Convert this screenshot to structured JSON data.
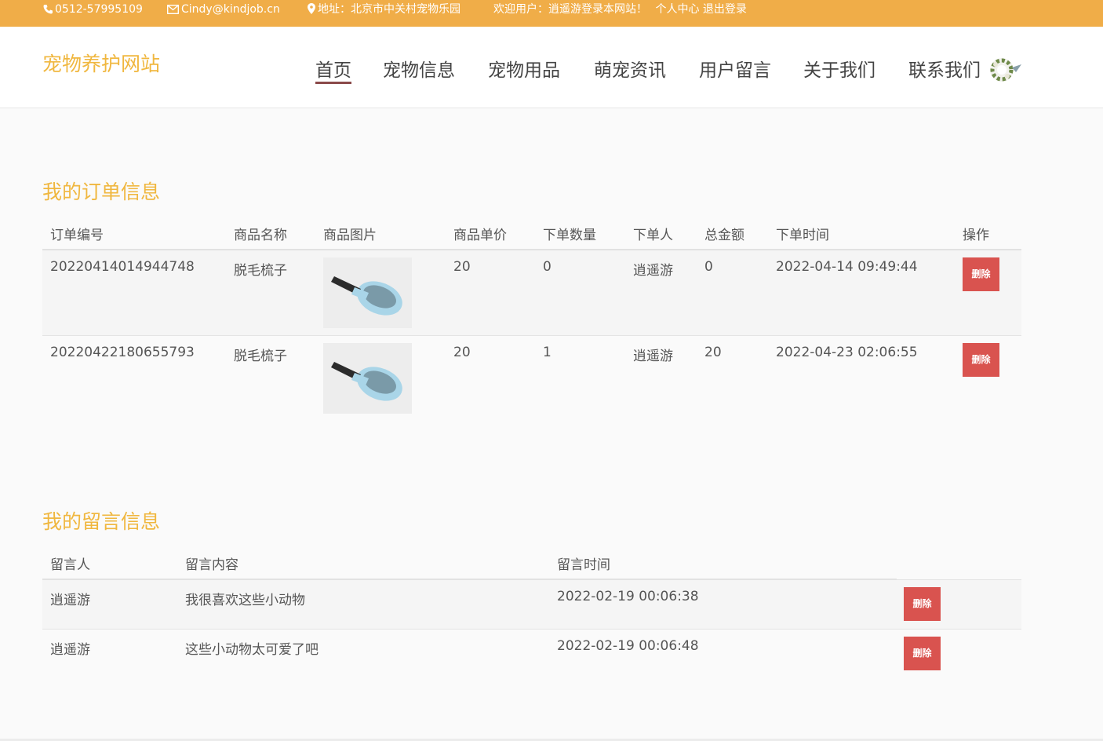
{
  "topbar": {
    "phone": "0512-57995109",
    "email": "Cindy@kindjob.cn",
    "address": "地址：北京市中关村宠物乐园",
    "welcome": "欢迎用户：逍遥游登录本网站！",
    "profile_link": "个人中心",
    "logout_link": "退出登录"
  },
  "header": {
    "logo": "宠物养护网站",
    "nav": [
      "首页",
      "宠物信息",
      "宠物用品",
      "萌宠资讯",
      "用户留言",
      "关于我们",
      "联系我们"
    ],
    "active_nav": "首页"
  },
  "orders": {
    "title": "我的订单信息",
    "headers": [
      "订单编号",
      "商品名称",
      "商品图片",
      "商品单价",
      "下单数量",
      "下单人",
      "总金额",
      "下单时间",
      "操作"
    ],
    "rows": [
      {
        "id": "20220414014944748",
        "name": "脱毛梳子",
        "image": "pet-brush-image",
        "price": "20",
        "qty": "0",
        "user": "逍遥游",
        "total": "0",
        "time": "2022-04-14 09:49:44",
        "action": "删除"
      },
      {
        "id": "20220422180655793",
        "name": "脱毛梳子",
        "image": "pet-brush-image",
        "price": "20",
        "qty": "1",
        "user": "逍遥游",
        "total": "20",
        "time": "2022-04-23 02:06:55",
        "action": "删除"
      }
    ]
  },
  "messages": {
    "title": "我的留言信息",
    "headers": [
      "留言人",
      "留言内容",
      "留言时间"
    ],
    "rows": [
      {
        "user": "逍遥游",
        "content": "我很喜欢这些小动物",
        "time": "2022-02-19 00:06:38",
        "action": "删除"
      },
      {
        "user": "逍遥游",
        "content": "这些小动物太可爱了吧",
        "time": "2022-02-19 00:06:48",
        "action": "删除"
      }
    ]
  },
  "colors": {
    "topbar": "#f0ad48",
    "accent": "#f0b73f",
    "danger": "#d9534f",
    "nav_underline": "#8b4a4a"
  }
}
